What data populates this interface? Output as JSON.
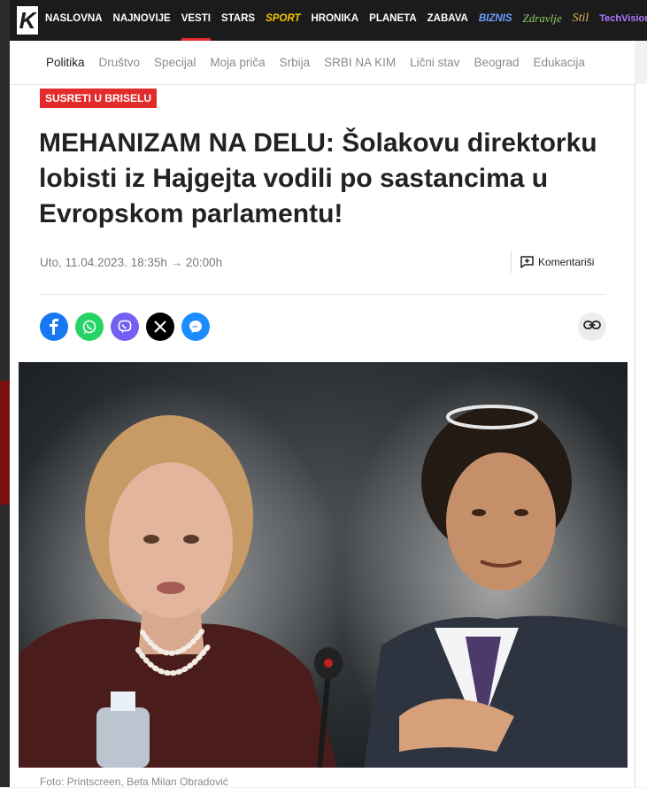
{
  "brand": {
    "logo_letter": "K"
  },
  "topnav": {
    "items": [
      "NASLOVNA",
      "NAJNOVIJE",
      "VESTI",
      "STARS",
      "SPORT",
      "HRONIKA",
      "PLANETA",
      "ZABAVA",
      "BIZNIS",
      "Zdravlje",
      "Stil",
      "TechVision"
    ],
    "active": "VESTI"
  },
  "subnav": {
    "items": [
      "Politika",
      "Društvo",
      "Specijal",
      "Moja priča",
      "Srbija",
      "SRBI NA KIM",
      "Lični stav",
      "Beograd",
      "Edukacija"
    ],
    "current": "Politika"
  },
  "article": {
    "tag": "SUSRETI U BRISELU",
    "headline": "MEHANIZAM NA DELU: Šolakovu direktorku lobisti iz Hajgejta vodili po sastancima u Evropskom parlamentu!",
    "meta": "Uto, 11.04.2023. 18:35h → 20:00h",
    "comments_label": "Komentariši",
    "share_icons": [
      "facebook-icon",
      "whatsapp-icon",
      "viber-icon",
      "x-icon",
      "messenger-icon"
    ],
    "caption": "Foto: Printscreen, Beta Milan Obradović"
  },
  "colors": {
    "accent": "#e32b2b",
    "nav_bg": "#1b1b1b",
    "sport": "#f5c400"
  }
}
